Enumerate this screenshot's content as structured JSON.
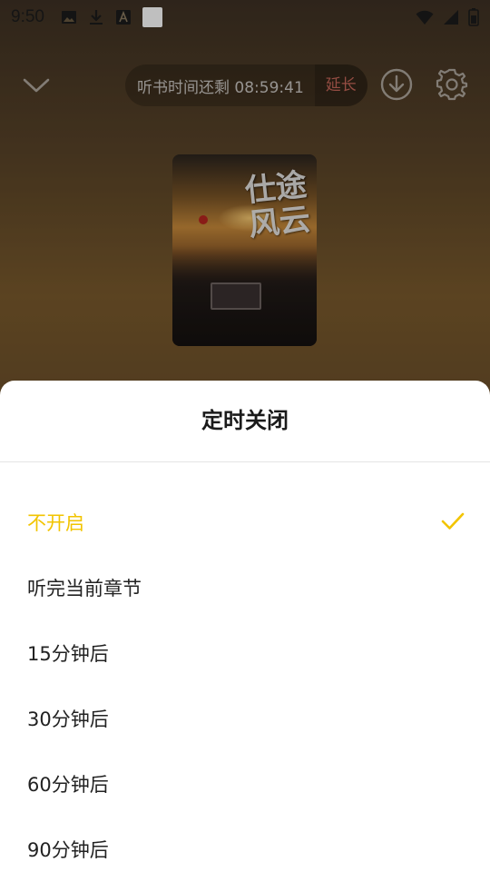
{
  "status_bar": {
    "time": "9:50",
    "left_icons": [
      "image-icon",
      "download-icon",
      "font-icon",
      "white-square-icon"
    ],
    "right_icons": [
      "wifi-icon",
      "signal-icon",
      "battery-icon"
    ]
  },
  "toolbar": {
    "timer_text": "听书时间还剩 08:59:41",
    "extend_label": "延长",
    "icons": [
      "chevron-down-icon",
      "download-icon",
      "gear-icon"
    ]
  },
  "cover": {
    "title_text": "仕途风云"
  },
  "sheet": {
    "title": "定时关闭",
    "options": [
      {
        "label": "不开启",
        "selected": true
      },
      {
        "label": "听完当前章节",
        "selected": false
      },
      {
        "label": "15分钟后",
        "selected": false
      },
      {
        "label": "30分钟后",
        "selected": false
      },
      {
        "label": "60分钟后",
        "selected": false
      },
      {
        "label": "90分钟后",
        "selected": false
      }
    ]
  },
  "colors": {
    "accent": "#f2c400",
    "extend": "#c7675a",
    "text": "#222222"
  }
}
